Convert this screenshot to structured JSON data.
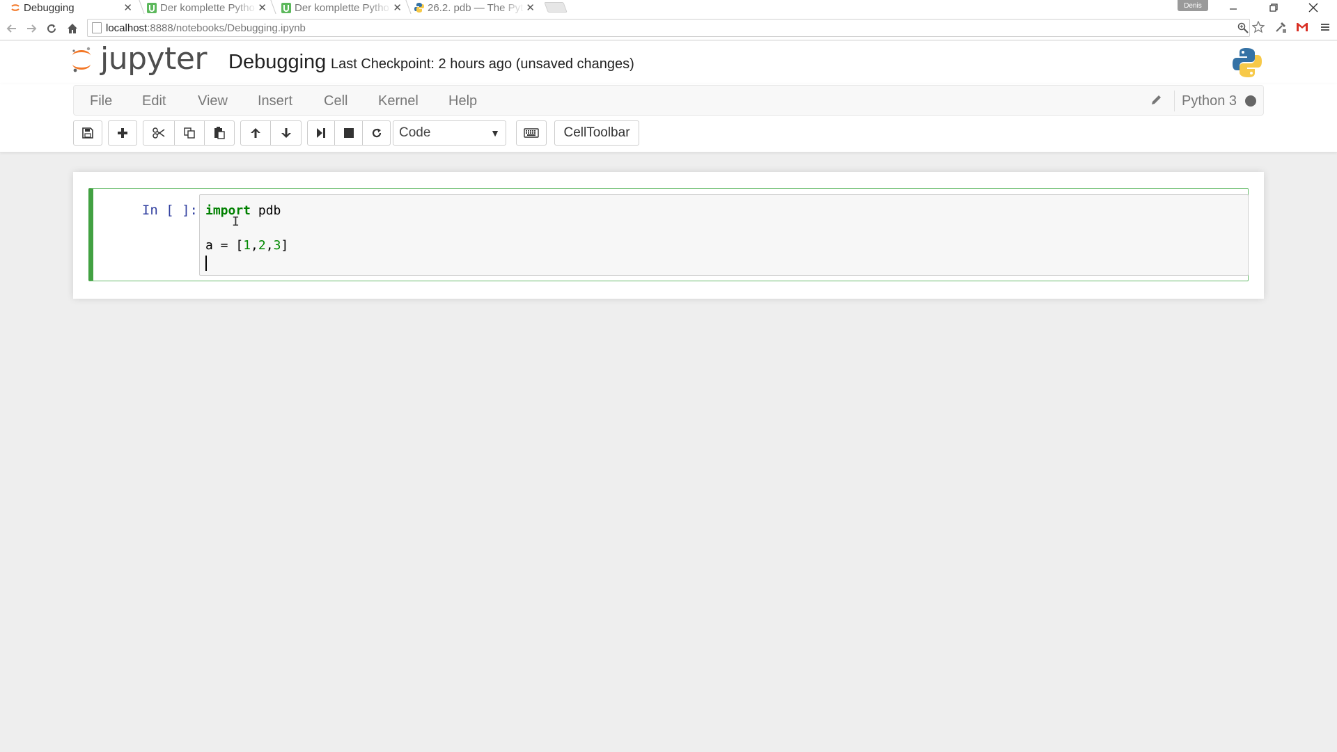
{
  "browser": {
    "tabs": [
      {
        "title": "Debugging",
        "active": true,
        "favicon": "jupyter-favicon"
      },
      {
        "title": "Der komplette Pytho",
        "active": false,
        "favicon": "udemy-favicon"
      },
      {
        "title": "Der komplette Pytho",
        "active": false,
        "favicon": "udemy-favicon"
      },
      {
        "title": "26.2. pdb — The Pyt",
        "active": false,
        "favicon": "python-favicon"
      }
    ],
    "profile_name": "Denis",
    "url_host": "localhost",
    "url_path": ":8888/notebooks/Debugging.ipynb"
  },
  "header": {
    "logo_text": "jupyter",
    "notebook_name": "Debugging",
    "checkpoint": "Last Checkpoint: 2 hours ago (unsaved changes)"
  },
  "menu": {
    "items": [
      "File",
      "Edit",
      "View",
      "Insert",
      "Cell",
      "Kernel",
      "Help"
    ],
    "kernel_name": "Python 3"
  },
  "toolbar": {
    "cell_type": "Code",
    "celltoolbar_label": "CellToolbar"
  },
  "cell": {
    "prompt": "In [ ]:",
    "line1_keyword": "import",
    "line1_rest": " pdb",
    "line2_var": "a = [",
    "line2_n1": "1",
    "line2_n2": "2",
    "line2_n3": "3",
    "line2_close": "]"
  },
  "colors": {
    "cell_selected_border": "#42a142",
    "prompt_color": "#303f9f",
    "keyword_color": "#008000",
    "jupyter_orange": "#f37726"
  }
}
